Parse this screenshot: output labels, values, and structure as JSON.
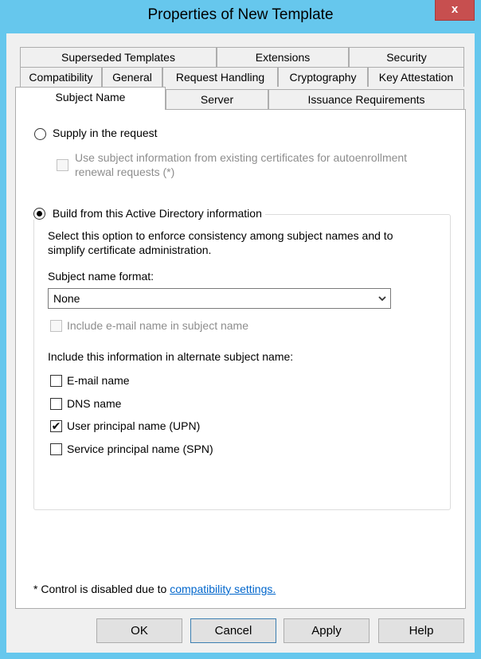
{
  "window": {
    "title": "Properties of New Template",
    "close_glyph": "x"
  },
  "tabs": {
    "row1": [
      "Superseded Templates",
      "Extensions",
      "Security"
    ],
    "row2": [
      "Compatibility",
      "General",
      "Request Handling",
      "Cryptography",
      "Key Attestation"
    ],
    "row3": [
      "Subject Name",
      "Server",
      "Issuance Requirements"
    ],
    "active": "Subject Name"
  },
  "supply": {
    "label": "Supply in the request",
    "checked": false,
    "sub_line1": "Use subject information from existing certificates for autoenrollment",
    "sub_line2": "renewal requests (*)"
  },
  "build": {
    "label": "Build from this Active Directory information",
    "checked": true,
    "desc_line1": "Select this option to enforce consistency among subject names and to",
    "desc_line2": "simplify certificate administration.",
    "format_label": "Subject name format:",
    "format_value": "None",
    "include_email": "Include e-mail name in subject name",
    "alt_label": "Include this information in alternate subject name:",
    "alt_options": [
      {
        "label": "E-mail name",
        "checked": false
      },
      {
        "label": "DNS name",
        "checked": false
      },
      {
        "label": "User principal name (UPN)",
        "checked": true
      },
      {
        "label": "Service principal name (SPN)",
        "checked": false
      }
    ]
  },
  "footnote": {
    "text": "* Control is disabled due to ",
    "link": "compatibility settings."
  },
  "buttons": {
    "ok": "OK",
    "cancel": "Cancel",
    "apply": "Apply",
    "help": "Help"
  },
  "colors": {
    "frame": "#66c7ed",
    "close": "#c74f4f",
    "link": "#0066cc"
  },
  "icons": {
    "check": "✔",
    "dropdown": "chevron-down-icon"
  }
}
